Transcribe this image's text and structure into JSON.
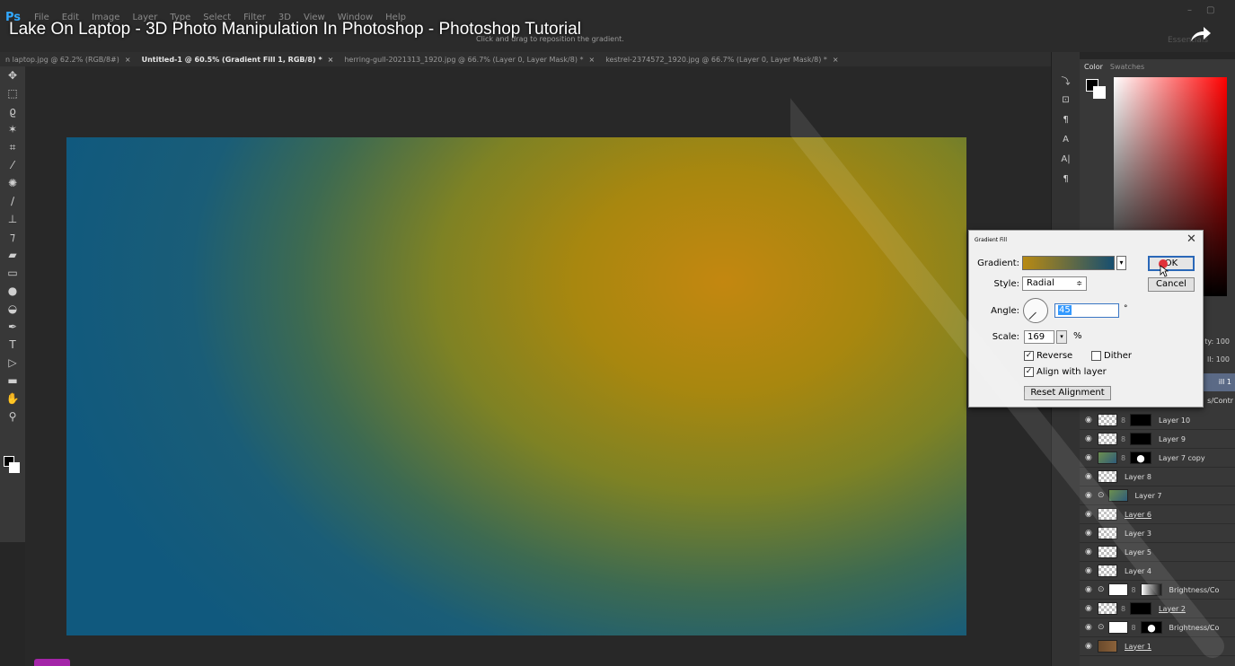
{
  "app": {
    "logo": "Ps",
    "menu": [
      "File",
      "Edit",
      "Image",
      "Layer",
      "Type",
      "Select",
      "Filter",
      "3D",
      "View",
      "Window",
      "Help"
    ],
    "video_title": "Lake On Laptop - 3D Photo Manipulation In Photoshop - Photoshop Tutorial",
    "status_hint": "Click and drag to reposition the gradient.",
    "workspace": "Essentials"
  },
  "tabs": [
    {
      "label": "n laptop.jpg @ 62.2% (RGB/8#)",
      "active": false
    },
    {
      "label": "Untitled-1 @ 60.5% (Gradient Fill 1, RGB/8) *",
      "active": true
    },
    {
      "label": "herring-gull-2021313_1920.jpg @ 66.7% (Layer 0, Layer Mask/8) *",
      "active": false
    },
    {
      "label": "kestrel-2374572_1920.jpg @ 66.7% (Layer 0, Layer Mask/8) *",
      "active": false
    }
  ],
  "color_panel": {
    "tab_color": "Color",
    "tab_swatches": "Swatches"
  },
  "layers_panel": {
    "opacity_label": "ty: 100",
    "fill_label": "ll: 100",
    "selected_layer": "ill 1",
    "adjust_label": "s/Contr",
    "layers": [
      {
        "name": "Layer 10",
        "thumb": "checker",
        "mask": "dark",
        "fx": false,
        "underline": false
      },
      {
        "name": "Layer 9",
        "thumb": "checker",
        "mask": "dark",
        "fx": false,
        "underline": false
      },
      {
        "name": "Layer 7 copy",
        "thumb": "photo",
        "mask": "blob",
        "fx": false,
        "underline": false
      },
      {
        "name": "Layer 8",
        "thumb": "checker",
        "mask": "",
        "fx": false,
        "underline": false
      },
      {
        "name": "Layer 7",
        "thumb": "photo",
        "mask": "",
        "fx": true,
        "underline": false
      },
      {
        "name": "Layer 6",
        "thumb": "checker",
        "mask": "",
        "fx": false,
        "underline": true
      },
      {
        "name": "Layer 3",
        "thumb": "checker",
        "mask": "",
        "fx": false,
        "underline": false
      },
      {
        "name": "Layer 5",
        "thumb": "checker",
        "mask": "",
        "fx": false,
        "underline": false
      },
      {
        "name": "Layer 4",
        "thumb": "checker",
        "mask": "",
        "fx": false,
        "underline": false
      },
      {
        "name": "Brightness/Co",
        "thumb": "white",
        "mask": "grad",
        "fx": true,
        "underline": false
      },
      {
        "name": "Layer 2",
        "thumb": "checker",
        "mask": "dark",
        "fx": false,
        "underline": true
      },
      {
        "name": "Brightness/Co",
        "thumb": "white",
        "mask": "blob",
        "fx": true,
        "underline": false
      },
      {
        "name": "Layer 1",
        "thumb": "wood",
        "mask": "",
        "fx": false,
        "underline": true
      }
    ]
  },
  "dialog": {
    "title": "Gradient Fill",
    "gradient_label": "Gradient:",
    "style_label": "Style:",
    "style_value": "Radial",
    "angle_label": "Angle:",
    "angle_value": "45",
    "degree_symbol": "°",
    "scale_label": "Scale:",
    "scale_value": "169",
    "percent_symbol": "%",
    "reverse_label": "Reverse",
    "reverse_checked": true,
    "dither_label": "Dither",
    "dither_checked": false,
    "align_label": "Align with layer",
    "align_checked": true,
    "reset_label": "Reset Alignment",
    "ok_label": "OK",
    "cancel_label": "Cancel",
    "gradient_start": "#b88a13",
    "gradient_end": "#174f70"
  },
  "canvas": {
    "highlight_color": "#c38710",
    "base_color": "#10597e"
  }
}
